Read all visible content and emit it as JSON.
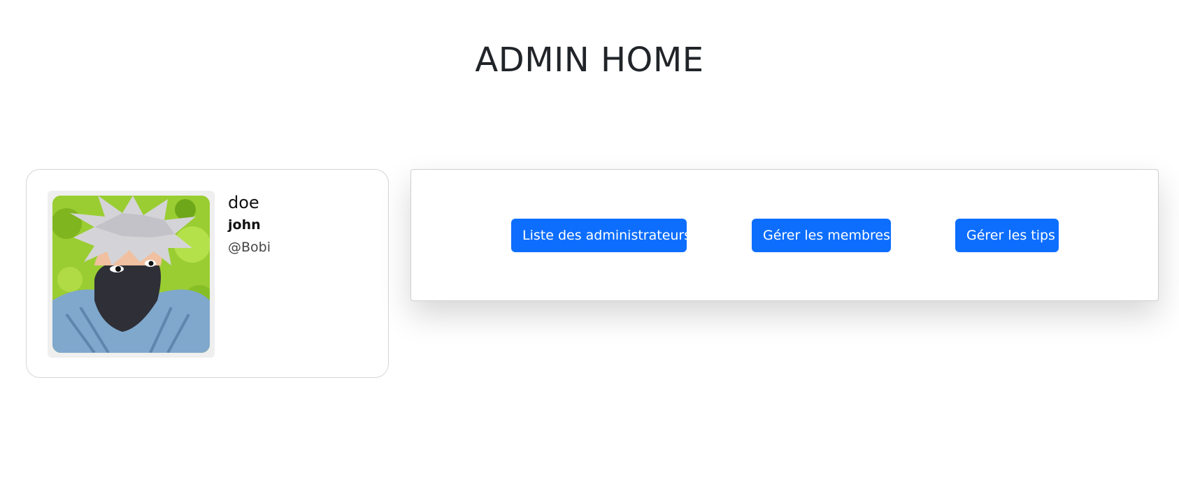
{
  "page": {
    "title": "ADMIN HOME"
  },
  "profile": {
    "last_name": "doe",
    "first_name": "john",
    "username": "@Bobi",
    "avatar_icon": "user-avatar-image"
  },
  "actions": {
    "admins_label": "Liste des administrateurs",
    "members_label": "Gérer les membres",
    "tips_label": "Gérer les tips"
  },
  "colors": {
    "primary": "#0d6efd",
    "text": "#212529",
    "border": "#d6d6d6"
  }
}
